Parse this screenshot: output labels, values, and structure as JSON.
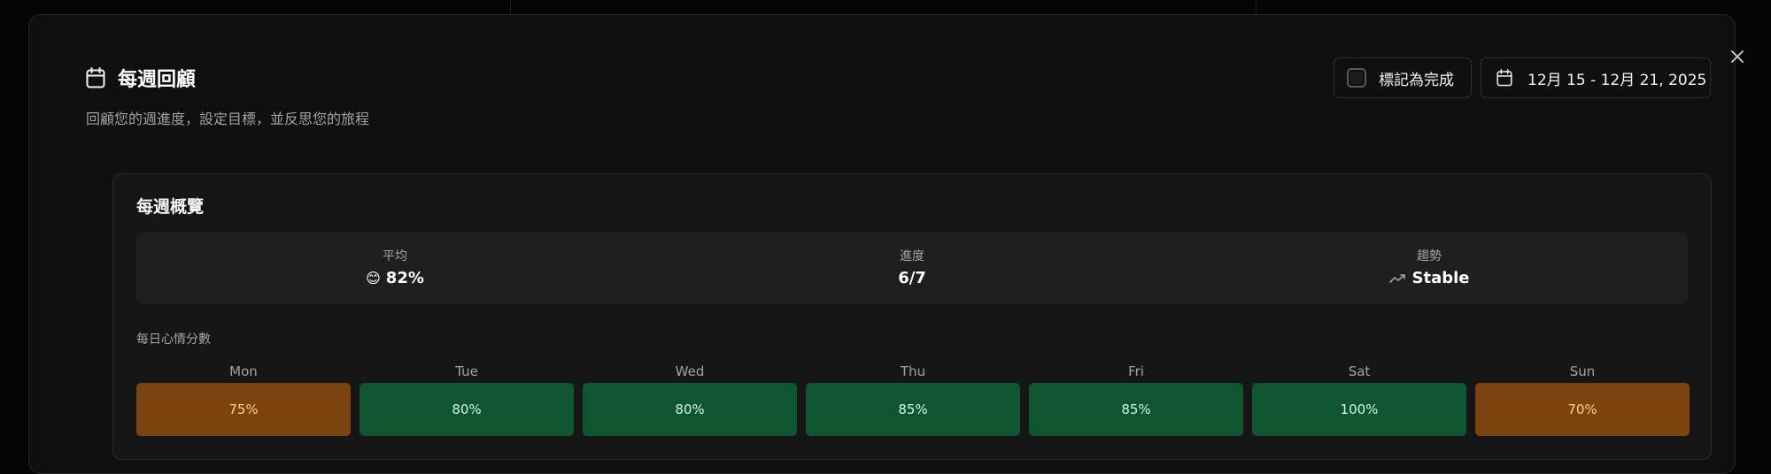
{
  "modal": {
    "title": "每週回顧",
    "subtitle": "回顧您的週進度，設定目標，並反思您的旅程",
    "mark_complete_label": "標記為完成",
    "date_range": "12月 15 - 12月 21, 2025",
    "close_icon": "close-icon",
    "title_icon": "calendar-icon"
  },
  "overview": {
    "title": "每週概覽",
    "stats": [
      {
        "label": "平均",
        "value": "82%",
        "icon": "smiling-face-emoji",
        "icon_glyph": "😊"
      },
      {
        "label": "進度",
        "value": "6/7"
      },
      {
        "label": "趨勢",
        "value": "Stable",
        "icon": "trend-icon"
      }
    ],
    "daily_label": "每日心情分數",
    "days": [
      {
        "name": "Mon",
        "score": "75%",
        "level": "amber"
      },
      {
        "name": "Tue",
        "score": "80%",
        "level": "green"
      },
      {
        "name": "Wed",
        "score": "80%",
        "level": "green"
      },
      {
        "name": "Thu",
        "score": "85%",
        "level": "green"
      },
      {
        "name": "Fri",
        "score": "85%",
        "level": "green"
      },
      {
        "name": "Sat",
        "score": "100%",
        "level": "green"
      },
      {
        "name": "Sun",
        "score": "70%",
        "level": "amber"
      }
    ]
  },
  "colors": {
    "background": "#050505",
    "modal": "#0f0f0f",
    "card": "#161616",
    "green_tile": "#0f5530",
    "amber_tile": "#7a4310"
  }
}
